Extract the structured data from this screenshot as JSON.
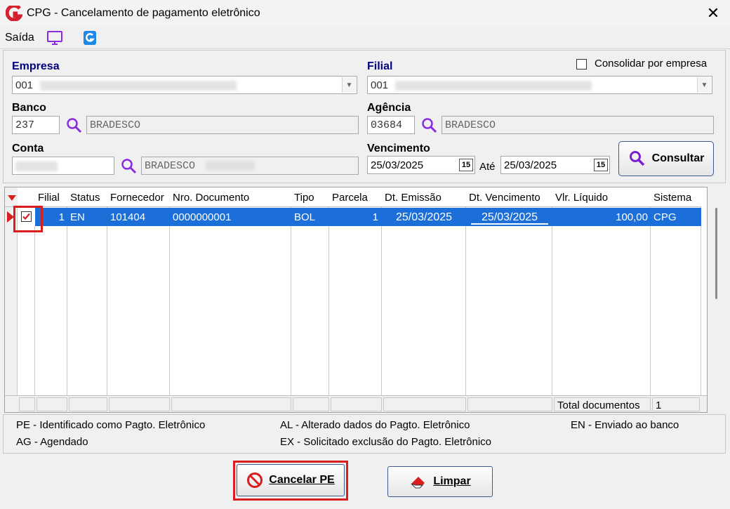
{
  "window": {
    "title": "CPG - Cancelamento de pagamento eletrônico",
    "close": "✕"
  },
  "toolbar": {
    "exit_label": "Saída"
  },
  "form": {
    "empresa_label": "Empresa",
    "empresa_code": "001",
    "filial_label": "Filial",
    "filial_code": "001",
    "consolidar_label": "Consolidar por empresa",
    "banco_label": "Banco",
    "banco_code": "237",
    "banco_name": "BRADESCO",
    "agencia_label": "Agência",
    "agencia_code": "03684",
    "agencia_name": "BRADESCO",
    "conta_label": "Conta",
    "conta_name": "BRADESCO",
    "vencimento_label": "Vencimento",
    "date_from": "25/03/2025",
    "ate_label": "Até",
    "date_to": "25/03/2025",
    "cal_icon_text": "15",
    "consultar_label": "Consultar"
  },
  "grid": {
    "headers": [
      "Filial",
      "Status",
      "Fornecedor",
      "Nro. Documento",
      "Tipo",
      "Parcela",
      "Dt. Emissão",
      "Dt. Vencimento",
      "Vlr. Líquido",
      "Sistema"
    ],
    "row": {
      "filial": "1",
      "status": "EN",
      "fornecedor": "101404",
      "documento": "0000000001",
      "tipo": "BOL",
      "parcela": "1",
      "emissao": "25/03/2025",
      "vencimento": "25/03/2025",
      "valor": "100,00",
      "sistema": "CPG",
      "checked": true
    },
    "total_label": "Total documentos",
    "total_value": "1"
  },
  "legend": {
    "pe": "PE - Identificado como Pagto. Eletrônico",
    "ag": "AG - Agendado",
    "al": "AL - Alterado dados do Pagto. Eletrônico",
    "ex": "EX - Solicitado exclusão do Pagto. Eletrônico",
    "en": "EN - Enviado ao banco"
  },
  "buttons": {
    "cancel": "Cancelar PE",
    "clear": "Limpar"
  },
  "colors": {
    "selection": "#1c6fd8",
    "highlight": "#d81e1e",
    "label_blue": "#000080",
    "icon_purple": "#8a2be2"
  }
}
